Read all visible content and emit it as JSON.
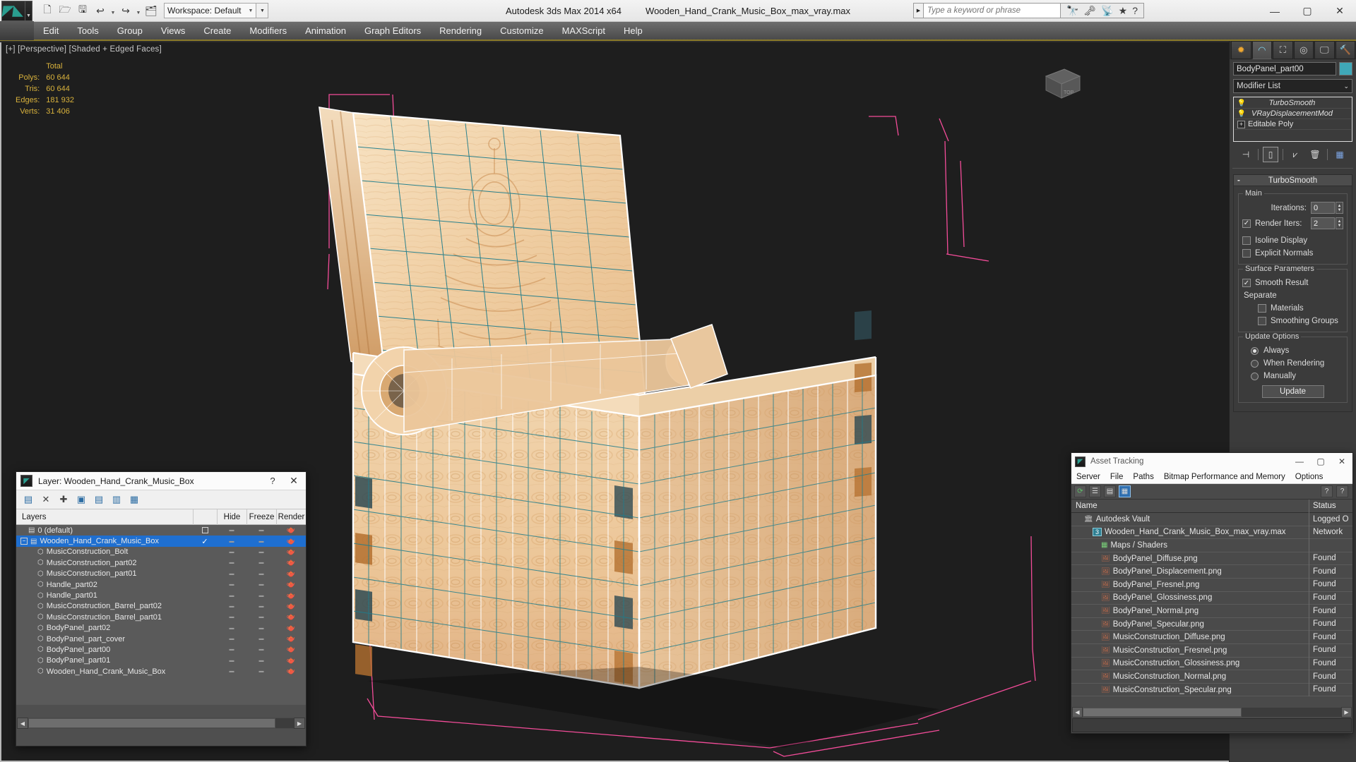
{
  "titlebar": {
    "app_title": "Autodesk 3ds Max  2014 x64",
    "file_title": "Wooden_Hand_Crank_Music_Box_max_vray.max",
    "workspace": "Workspace: Default",
    "search_placeholder": "Type a keyword or phrase",
    "quick_access": [
      {
        "name": "new-file-icon",
        "glyph": "🗋"
      },
      {
        "name": "open-file-icon",
        "glyph": "🗁"
      },
      {
        "name": "save-file-icon",
        "glyph": "🖫"
      },
      {
        "name": "undo-icon",
        "glyph": "↩"
      },
      {
        "name": "redo-icon",
        "glyph": "↪"
      },
      {
        "name": "set-project-folder-icon",
        "glyph": "🗂"
      }
    ],
    "search_icons": [
      {
        "name": "binoculars-icon",
        "glyph": "🔭"
      },
      {
        "name": "key-icon",
        "glyph": "🗝"
      },
      {
        "name": "satellite-dish-icon",
        "glyph": "📡"
      },
      {
        "name": "favorites-star-icon",
        "glyph": "★"
      },
      {
        "name": "help-icon",
        "glyph": "?"
      }
    ],
    "window_buttons": [
      {
        "name": "minimize-button",
        "glyph": "—"
      },
      {
        "name": "maximize-button",
        "glyph": "▢"
      },
      {
        "name": "close-button",
        "glyph": "✕"
      }
    ]
  },
  "menubar": {
    "items": [
      "Edit",
      "Tools",
      "Group",
      "Views",
      "Create",
      "Modifiers",
      "Animation",
      "Graph Editors",
      "Rendering",
      "Customize",
      "MAXScript",
      "Help"
    ]
  },
  "viewport": {
    "label": "[+] [Perspective] [Shaded + Edged Faces]",
    "stats": {
      "header": "Total",
      "rows": [
        {
          "label": "Polys:",
          "value": "60 644"
        },
        {
          "label": "Tris:",
          "value": "60 644"
        },
        {
          "label": "Edges:",
          "value": "181 932"
        },
        {
          "label": "Verts:",
          "value": "31 406"
        }
      ]
    },
    "background_color": "#1e1e1e",
    "wood_light": "#f6ddb9",
    "wood_mid": "#ecc697",
    "wood_dark": "#c98a4e",
    "wire_color": "#1f7d8c",
    "selection_color": "#ff4fa0"
  },
  "command_panel": {
    "tabs": [
      {
        "name": "create-tab",
        "glyph": "✹"
      },
      {
        "name": "modify-tab",
        "glyph": "◠"
      },
      {
        "name": "hierarchy-tab",
        "glyph": "⛶"
      },
      {
        "name": "motion-tab",
        "glyph": "◎"
      },
      {
        "name": "display-tab",
        "glyph": "🖵"
      },
      {
        "name": "utilities-tab",
        "glyph": "🔨"
      }
    ],
    "object_name": "BodyPanel_part00",
    "object_color": "#3fa8b8",
    "modifier_list_label": "Modifier List",
    "stack": [
      {
        "label": "TurboSmooth",
        "italic": true,
        "icon": "lightbulb-icon"
      },
      {
        "label": "VRayDisplacementMod",
        "italic": true,
        "icon": "lightbulb-icon"
      },
      {
        "label": "Editable Poly",
        "italic": false,
        "icon": "expand-plus-icon"
      }
    ],
    "stack_tools": [
      {
        "name": "pin-stack-icon",
        "glyph": "⊣"
      },
      {
        "name": "show-end-result-icon",
        "glyph": "▯"
      },
      {
        "name": "make-unique-icon",
        "glyph": "⩗"
      },
      {
        "name": "remove-modifier-icon",
        "glyph": "🗑"
      },
      {
        "name": "configure-modifier-sets-icon",
        "glyph": "▦"
      }
    ],
    "turbosmooth": {
      "title": "TurboSmooth",
      "collapse_glyph": "-",
      "main_group": "Main",
      "iterations_label": "Iterations:",
      "iterations_value": "0",
      "render_iters_label": "Render Iters:",
      "render_iters_value": "2",
      "render_iters_checked": true,
      "isoline_display_label": "Isoline Display",
      "isoline_display_checked": false,
      "explicit_normals_label": "Explicit Normals",
      "explicit_normals_checked": false,
      "surface_group": "Surface Parameters",
      "smooth_result_label": "Smooth Result",
      "smooth_result_checked": true,
      "separate_label": "Separate",
      "materials_label": "Materials",
      "materials_checked": false,
      "smoothing_groups_label": "Smoothing Groups",
      "smoothing_groups_checked": false,
      "update_group": "Update Options",
      "update_options": [
        "Always",
        "When Rendering",
        "Manually"
      ],
      "update_selected": "Always",
      "update_button": "Update"
    }
  },
  "layer_dialog": {
    "title": "Layer: Wooden_Hand_Crank_Music_Box",
    "help_glyph": "?",
    "close_glyph": "✕",
    "toolbar": [
      {
        "name": "new-layer-icon",
        "glyph": "▤"
      },
      {
        "name": "delete-layer-icon",
        "glyph": "✕"
      },
      {
        "name": "add-to-layer-icon",
        "glyph": "✚"
      },
      {
        "name": "select-objects-in-layer-icon",
        "glyph": "▣"
      },
      {
        "name": "select-highlighted-layers-icon",
        "glyph": "▤"
      },
      {
        "name": "highlight-selected-objects-layer-icon",
        "glyph": "▥"
      },
      {
        "name": "layer-properties-icon",
        "glyph": "▦"
      }
    ],
    "columns": [
      "Layers",
      "",
      "Hide",
      "Freeze",
      "Render"
    ],
    "rows": [
      {
        "name": "0 (default)",
        "indent": 1,
        "selected": false,
        "icon": "layer-icon",
        "check": "box"
      },
      {
        "name": "Wooden_Hand_Crank_Music_Box",
        "indent": 0,
        "selected": true,
        "icon": "layer-icon",
        "check": "tick",
        "expander": "−"
      },
      {
        "name": "MusicConstruction_Bolt",
        "indent": 2,
        "selected": false,
        "icon": "object-icon",
        "check": ""
      },
      {
        "name": "MusicConstruction_part02",
        "indent": 2,
        "selected": false,
        "icon": "object-icon",
        "check": ""
      },
      {
        "name": "MusicConstruction_part01",
        "indent": 2,
        "selected": false,
        "icon": "object-icon",
        "check": ""
      },
      {
        "name": "Handle_part02",
        "indent": 2,
        "selected": false,
        "icon": "object-icon",
        "check": ""
      },
      {
        "name": "Handle_part01",
        "indent": 2,
        "selected": false,
        "icon": "object-icon",
        "check": ""
      },
      {
        "name": "MusicConstruction_Barrel_part02",
        "indent": 2,
        "selected": false,
        "icon": "object-icon",
        "check": ""
      },
      {
        "name": "MusicConstruction_Barrel_part01",
        "indent": 2,
        "selected": false,
        "icon": "object-icon",
        "check": ""
      },
      {
        "name": "BodyPanel_part02",
        "indent": 2,
        "selected": false,
        "icon": "object-icon",
        "check": ""
      },
      {
        "name": "BodyPanel_part_cover",
        "indent": 2,
        "selected": false,
        "icon": "object-icon",
        "check": ""
      },
      {
        "name": "BodyPanel_part00",
        "indent": 2,
        "selected": false,
        "icon": "object-icon",
        "check": ""
      },
      {
        "name": "BodyPanel_part01",
        "indent": 2,
        "selected": false,
        "icon": "object-icon",
        "check": ""
      },
      {
        "name": "Wooden_Hand_Crank_Music_Box",
        "indent": 2,
        "selected": false,
        "icon": "object-icon",
        "check": ""
      }
    ]
  },
  "asset_tracking": {
    "title": "Asset Tracking",
    "window_buttons": [
      {
        "name": "minimize-button",
        "glyph": "—"
      },
      {
        "name": "maximize-button",
        "glyph": "▢"
      },
      {
        "name": "close-button",
        "glyph": "✕"
      }
    ],
    "menu": [
      "Server",
      "File",
      "Paths",
      "Bitmap Performance and Memory",
      "Options"
    ],
    "toolbar": [
      {
        "name": "refresh-icon",
        "glyph": "⟳",
        "active": false
      },
      {
        "name": "list-view-icon",
        "glyph": "☰",
        "active": false
      },
      {
        "name": "detail-view-icon",
        "glyph": "▤",
        "active": false
      },
      {
        "name": "grid-view-icon",
        "glyph": "▦",
        "active": true
      }
    ],
    "toolbar_right": [
      {
        "name": "help-globe-icon",
        "glyph": "?"
      },
      {
        "name": "context-help-icon",
        "glyph": "?"
      }
    ],
    "columns": [
      "Name",
      "Status"
    ],
    "rows": [
      {
        "name": "Autodesk Vault",
        "status": "Logged O",
        "indent": 1,
        "icon": "vault-icon"
      },
      {
        "name": "Wooden_Hand_Crank_Music_Box_max_vray.max",
        "status": "Network",
        "indent": 2,
        "icon": "max-file-icon"
      },
      {
        "name": "Maps / Shaders",
        "status": "",
        "indent": 3,
        "icon": "maps-icon"
      },
      {
        "name": "BodyPanel_Diffuse.png",
        "status": "Found",
        "indent": 3,
        "icon": "bitmap-icon"
      },
      {
        "name": "BodyPanel_Displacement.png",
        "status": "Found",
        "indent": 3,
        "icon": "bitmap-icon"
      },
      {
        "name": "BodyPanel_Fresnel.png",
        "status": "Found",
        "indent": 3,
        "icon": "bitmap-icon"
      },
      {
        "name": "BodyPanel_Glossiness.png",
        "status": "Found",
        "indent": 3,
        "icon": "bitmap-icon"
      },
      {
        "name": "BodyPanel_Normal.png",
        "status": "Found",
        "indent": 3,
        "icon": "bitmap-icon"
      },
      {
        "name": "BodyPanel_Specular.png",
        "status": "Found",
        "indent": 3,
        "icon": "bitmap-icon"
      },
      {
        "name": "MusicConstruction_Diffuse.png",
        "status": "Found",
        "indent": 3,
        "icon": "bitmap-icon"
      },
      {
        "name": "MusicConstruction_Fresnel.png",
        "status": "Found",
        "indent": 3,
        "icon": "bitmap-icon"
      },
      {
        "name": "MusicConstruction_Glossiness.png",
        "status": "Found",
        "indent": 3,
        "icon": "bitmap-icon"
      },
      {
        "name": "MusicConstruction_Normal.png",
        "status": "Found",
        "indent": 3,
        "icon": "bitmap-icon"
      },
      {
        "name": "MusicConstruction_Specular.png",
        "status": "Found",
        "indent": 3,
        "icon": "bitmap-icon"
      }
    ]
  }
}
